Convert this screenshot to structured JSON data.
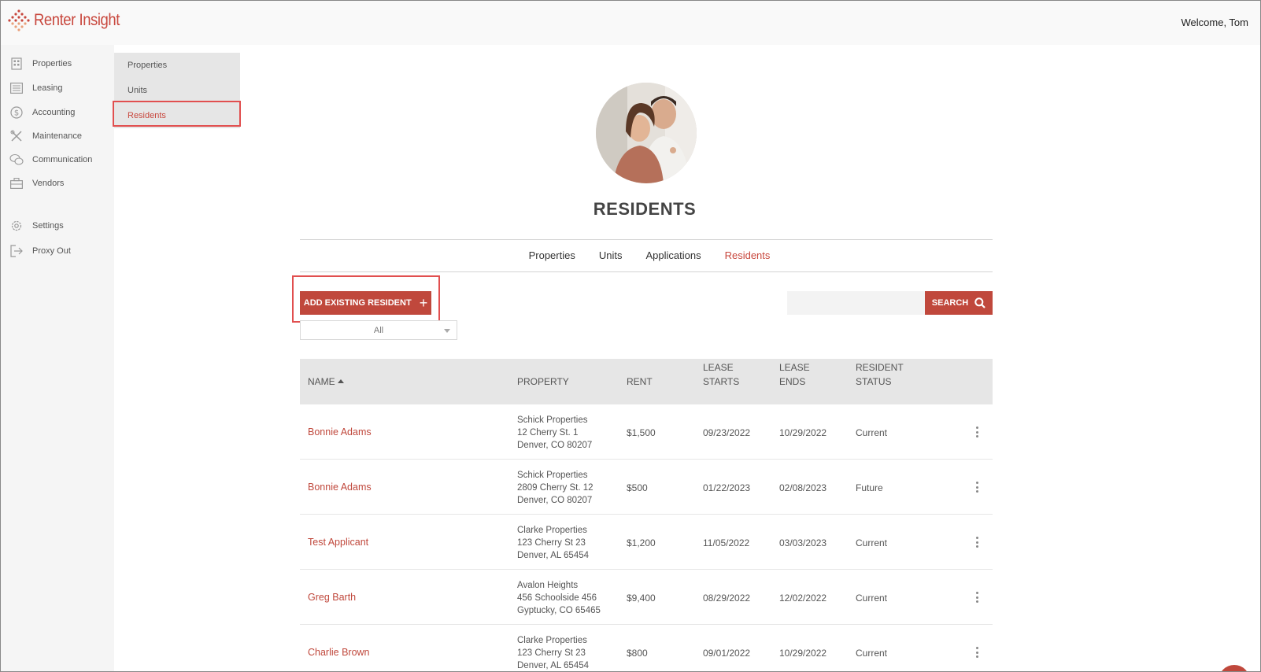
{
  "header": {
    "brand": "Renter Insight",
    "welcome": "Welcome, Tom"
  },
  "sidebar": {
    "items": [
      {
        "label": "Properties",
        "icon": "building-icon"
      },
      {
        "label": "Leasing",
        "icon": "list-icon"
      },
      {
        "label": "Accounting",
        "icon": "dollar-icon"
      },
      {
        "label": "Maintenance",
        "icon": "tools-icon"
      },
      {
        "label": "Communication",
        "icon": "chat-icon"
      },
      {
        "label": "Vendors",
        "icon": "briefcase-icon"
      },
      {
        "label": "Settings",
        "icon": "gear-icon"
      },
      {
        "label": "Proxy Out",
        "icon": "logout-icon"
      }
    ]
  },
  "subnav": {
    "items": [
      "Properties",
      "Units",
      "Residents"
    ],
    "active": "Residents"
  },
  "main": {
    "title": "RESIDENTS",
    "tabs": [
      "Properties",
      "Units",
      "Applications",
      "Residents"
    ],
    "active_tab": "Residents",
    "add_button": "ADD EXISTING RESIDENT",
    "filter_value": "All",
    "search_placeholder": "",
    "search_button": "SEARCH"
  },
  "table": {
    "headers": {
      "name": "NAME",
      "property": "PROPERTY",
      "rent": "RENT",
      "lease_starts_1": "LEASE",
      "lease_starts_2": "STARTS",
      "lease_ends_1": "LEASE",
      "lease_ends_2": "ENDS",
      "status_1": "RESIDENT",
      "status_2": "STATUS"
    },
    "rows": [
      {
        "name": "Bonnie Adams",
        "prop1": "Schick Properties",
        "prop2": "12 Cherry St. 1",
        "prop3": "Denver, CO 80207",
        "rent": "$1,500",
        "start": "09/23/2022",
        "end": "10/29/2022",
        "status": "Current"
      },
      {
        "name": "Bonnie Adams",
        "prop1": "Schick Properties",
        "prop2": "2809 Cherry St. 12",
        "prop3": "Denver, CO 80207",
        "rent": "$500",
        "start": "01/22/2023",
        "end": "02/08/2023",
        "status": "Future"
      },
      {
        "name": "Test Applicant",
        "prop1": "Clarke Properties",
        "prop2": "123 Cherry St 23",
        "prop3": "Denver, AL 65454",
        "rent": "$1,200",
        "start": "11/05/2022",
        "end": "03/03/2023",
        "status": "Current"
      },
      {
        "name": "Greg Barth",
        "prop1": "Avalon Heights",
        "prop2": "456 Schoolside 456",
        "prop3": "Gyptucky, CO 65465",
        "rent": "$9,400",
        "start": "08/29/2022",
        "end": "12/02/2022",
        "status": "Current"
      },
      {
        "name": "Charlie Brown",
        "prop1": "Clarke Properties",
        "prop2": "123 Cherry St 23",
        "prop3": "Denver, AL 65454",
        "rent": "$800",
        "start": "09/01/2022",
        "end": "10/29/2022",
        "status": "Current"
      }
    ]
  },
  "colors": {
    "accent": "#c0483c",
    "highlight": "#e14f4f"
  }
}
